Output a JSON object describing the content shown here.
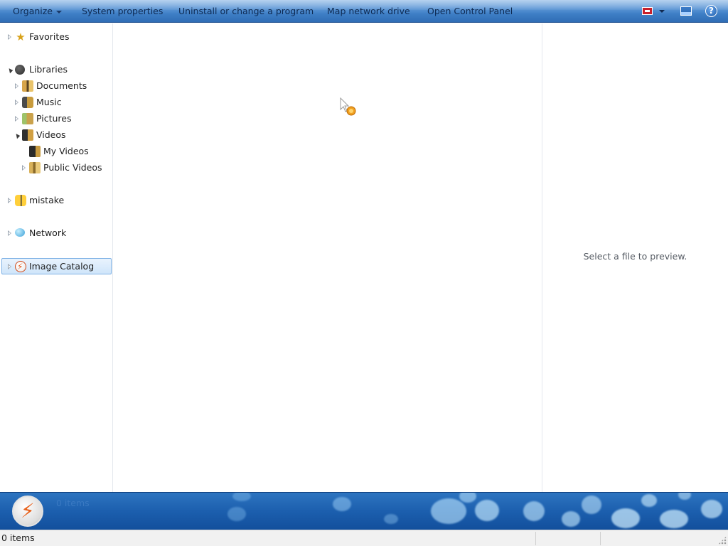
{
  "toolbar": {
    "organize": "Organize",
    "system_properties": "System properties",
    "uninstall": "Uninstall or change a program",
    "map_drive": "Map network drive",
    "control_panel": "Open Control Panel",
    "help_glyph": "?"
  },
  "nav": {
    "favorites": "Favorites",
    "libraries": "Libraries",
    "documents": "Documents",
    "music": "Music",
    "pictures": "Pictures",
    "videos": "Videos",
    "my_videos": "My Videos",
    "public_videos": "Public Videos",
    "homegroup": "mistake",
    "network": "Network",
    "image_catalog": "Image Catalog"
  },
  "preview": {
    "message": "Select a file to preview."
  },
  "details": {
    "count": "0 items"
  },
  "status": {
    "count": "0 items"
  },
  "colors": {
    "toolbar_top": "#8fb9e6",
    "toolbar_bottom": "#2f6db5",
    "details_bg": "#1c5fae",
    "selection_border": "#7fb2e6"
  }
}
